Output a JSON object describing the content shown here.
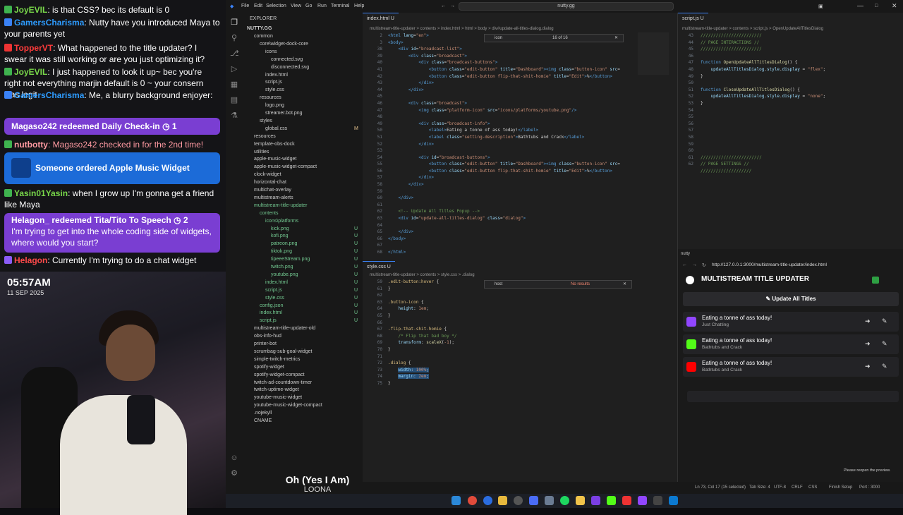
{
  "chat": {
    "messages": [
      {
        "user": "JoyEVIL",
        "user_color": "#79d84a",
        "text": ": is that CSS? bec its default is 0",
        "badge_color": "#3fb34f"
      },
      {
        "user": "GamersCharisma",
        "user_color": "#2e9cff",
        "text": ": Nutty have you introduced Maya to your parents yet",
        "badge_color": "#3b82f6"
      },
      {
        "user": "TopperVT",
        "user_color": "#ff3b3b",
        "text": ": What happened to the title updater? I swear it was still working or are you just optimizing it?",
        "badge_color": "#e33"
      },
      {
        "user": "JoyEVIL",
        "user_color": "#79d84a",
        "text": ": I just happened to look it up~ bec you're right not everything marjin default is 0 ~ your consern was legit",
        "badge_color": "#3fb34f"
      },
      {
        "user": "GamersCharisma",
        "user_color": "#2e9cff",
        "text": ": Me, a blurry background enjoyer:",
        "badge_color": "#3b82f6"
      },
      {
        "user": "nutbotty",
        "user_color": "#ff9aa2",
        "text": ": Magaso242 checked in for the 2nd time!",
        "badge_color": "#3fb34f"
      },
      {
        "user": "Yasin01Yasin",
        "user_color": "#79d84a",
        "text": ": when I grow up I'm gonna get a friend like Maya",
        "badge_color": "#3fb34f"
      },
      {
        "user": "Helagon",
        "user_color": "#ff4a4a",
        "text": ": Currently I'm trying to do a chat widget",
        "badge_color": "#8b5cf6"
      }
    ],
    "redeem1": "Magaso242 redeemed Daily Check-in ◷ 1",
    "redeem2_title": "Helagon_ redeemed Tita/Tito To Speech ◷ 2",
    "redeem2_text": "I'm trying to get into the whole coding side of widgets, where would you start?",
    "order": "Someone ordered Apple Music Widget"
  },
  "cam": {
    "time": "05:57AM",
    "date": "11 SEP 2025"
  },
  "now_playing": {
    "song": "Oh (Yes I Am)",
    "artist": "LOONA"
  },
  "vscode": {
    "menu": [
      "File",
      "Edit",
      "Selection",
      "View",
      "Go",
      "Run",
      "Terminal",
      "Help"
    ],
    "search": "nutty.gg",
    "explorer_title": "EXPLORER",
    "workspace": "NUTTY.GG",
    "tree": [
      {
        "label": "common",
        "d": 1,
        "c": "#ccc"
      },
      {
        "label": "core\\widget-dock-core",
        "d": 2
      },
      {
        "label": "icons",
        "d": 3
      },
      {
        "label": "connected.svg",
        "d": 4
      },
      {
        "label": "disconnected.svg",
        "d": 4
      },
      {
        "label": "index.html",
        "d": 3
      },
      {
        "label": "script.js",
        "d": 3
      },
      {
        "label": "style.css",
        "d": 3
      },
      {
        "label": "resources",
        "d": 2
      },
      {
        "label": "logo.png",
        "d": 3
      },
      {
        "label": "streamer.bot.png",
        "d": 3
      },
      {
        "label": "styles",
        "d": 2
      },
      {
        "label": "global.css",
        "d": 3,
        "u": "M"
      },
      {
        "label": "resources",
        "d": 1
      },
      {
        "label": "template-obs-dock",
        "d": 1
      },
      {
        "label": "utilities",
        "d": 1
      },
      {
        "label": "apple-music-widget",
        "d": 1
      },
      {
        "label": "apple-music-widget-compact",
        "d": 1
      },
      {
        "label": "clock-widget",
        "d": 1
      },
      {
        "label": "horizontal-chat",
        "d": 1
      },
      {
        "label": "multichat-overlay",
        "d": 1
      },
      {
        "label": "multistream-alerts",
        "d": 1
      },
      {
        "label": "multistream-title-updater",
        "d": 1,
        "c": "#73c991"
      },
      {
        "label": "contents",
        "d": 2,
        "c": "#73c991"
      },
      {
        "label": "icons\\platforms",
        "d": 3,
        "c": "#73c991"
      },
      {
        "label": "kick.png",
        "d": 4,
        "c": "#73c991",
        "u": "U"
      },
      {
        "label": "kofi.png",
        "d": 4,
        "c": "#73c991",
        "u": "U"
      },
      {
        "label": "patreon.png",
        "d": 4,
        "c": "#73c991",
        "u": "U"
      },
      {
        "label": "tiktok.png",
        "d": 4,
        "c": "#73c991",
        "u": "U"
      },
      {
        "label": "tipeeeStream.png",
        "d": 4,
        "c": "#73c991",
        "u": "U"
      },
      {
        "label": "twitch.png",
        "d": 4,
        "c": "#73c991",
        "u": "U"
      },
      {
        "label": "youtube.png",
        "d": 4,
        "c": "#73c991",
        "u": "U"
      },
      {
        "label": "index.html",
        "d": 3,
        "c": "#73c991",
        "u": "U"
      },
      {
        "label": "script.js",
        "d": 3,
        "c": "#73c991",
        "u": "U"
      },
      {
        "label": "style.css",
        "d": 3,
        "c": "#73c991",
        "u": "U"
      },
      {
        "label": "config.json",
        "d": 2,
        "c": "#73c991",
        "u": "U"
      },
      {
        "label": "index.html",
        "d": 2,
        "c": "#73c991",
        "u": "U"
      },
      {
        "label": "script.js",
        "d": 2,
        "c": "#73c991",
        "u": "U"
      },
      {
        "label": "multistream-title-updater-old",
        "d": 1
      },
      {
        "label": "obs-info-hud",
        "d": 1
      },
      {
        "label": "printer-bot",
        "d": 1
      },
      {
        "label": "scrumbag-sub-goal-widget",
        "d": 1
      },
      {
        "label": "simple-twitch-metrics",
        "d": 1
      },
      {
        "label": "spotify-widget",
        "d": 1
      },
      {
        "label": "spotify-widget-compact",
        "d": 1
      },
      {
        "label": "twitch-ad-countdown-timer",
        "d": 1
      },
      {
        "label": "twitch-uptime-widget",
        "d": 1
      },
      {
        "label": "youtube-music-widget",
        "d": 1
      },
      {
        "label": "youtube-music-widget-compact",
        "d": 1
      },
      {
        "label": ".nojekyll",
        "d": 1
      },
      {
        "label": "CNAME",
        "d": 1
      }
    ],
    "tab_html": "index.html U",
    "tab_css": "style.css U",
    "tab_js": "script.js U",
    "crumb_html": "multistream-title-updater > contents > index.html > html > body > div#update-all-titles-dialog.dialog",
    "crumb_css": "multistream-title-updater > contents > style.css > .dialog",
    "crumb_js": "multistream-title-updater > contents > script.js > OpenUpdateAllTitlesDialog",
    "find_html": {
      "query": "icon",
      "count": "16 of 16"
    },
    "find_css": {
      "query": "host",
      "count": "No results"
    },
    "html_lines": [
      "2",
      "3",
      "38",
      "39",
      "40",
      "41",
      "42",
      "43",
      "44",
      "45",
      "46",
      "47",
      "48",
      "49",
      "50",
      "51",
      "52",
      "53",
      "54",
      "55",
      "56",
      "57",
      "58",
      "59",
      "60",
      "61",
      "62",
      "63",
      "64",
      "65",
      "66",
      "67",
      "68"
    ],
    "css_lines": [
      "59",
      "61",
      "62",
      "63",
      "64",
      "65",
      "66",
      "67",
      "68",
      "69",
      "70",
      "71",
      "72",
      "73",
      "74",
      "75"
    ],
    "js_lines": [
      "43",
      "44",
      "45",
      "46",
      "47",
      "48",
      "49",
      "50",
      "51",
      "52",
      "53",
      "54",
      "55",
      "56",
      "57",
      "58",
      "59",
      "60",
      "61",
      "62"
    ],
    "status": {
      "pos": "Ln 73, Col 17 (15 selected)",
      "tab": "Tab Size: 4",
      "enc": "UTF-8",
      "eol": "CRLF",
      "lang": "CSS",
      "setup": "Finish Setup",
      "port": "Port : 3000"
    }
  },
  "browser": {
    "tab": "nutty",
    "url": "http://127.0.0.1:3000/multistream-title-updater/index.html",
    "app_title": "MULTISTREAM TITLE UPDATER",
    "update_all": "Update All Titles",
    "broadcasts": [
      {
        "title": "Eating a tonne of ass today!",
        "sub": "Just Chatting",
        "color": "#9146ff"
      },
      {
        "title": "Eating a tonne of ass today!",
        "sub": "Bathtubs and Crack",
        "color": "#53fc18"
      },
      {
        "title": "Eating a tonne of ass today!",
        "sub": "Bathtubs and Crack",
        "color": "#ff0000"
      }
    ],
    "reopen": "Please reopen the preview."
  }
}
